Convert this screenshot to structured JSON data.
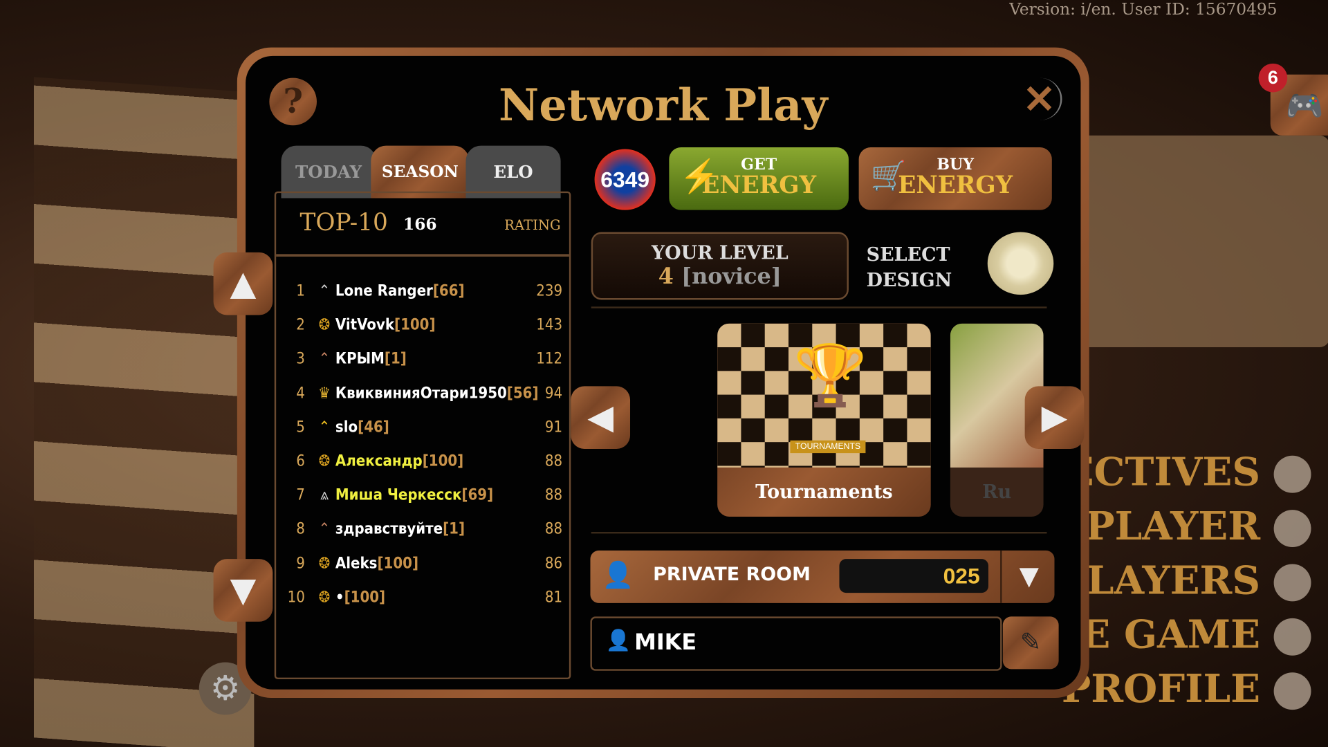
{
  "version_text": "Version:  i/en. User ID: 15670495",
  "notification_count": "6",
  "background_menu": [
    "JECTIVES",
    "PLAYER",
    "PLAYERS",
    "NE GAME",
    "PROFILE"
  ],
  "modal": {
    "title": "Network Play",
    "tabs": [
      {
        "label": "TODAY",
        "active": false
      },
      {
        "label": "SEASON 166",
        "active": true
      },
      {
        "label": "ELO",
        "active": false
      }
    ],
    "leaderboard": {
      "title": "TOP-10",
      "rating_label": "RATING",
      "rows": [
        {
          "rank": "1",
          "name": "Lone Ranger",
          "level": "[66]",
          "rating": "239",
          "name_color": "#ffffff",
          "icon": "chevron-silver"
        },
        {
          "rank": "2",
          "name": "VitVovk",
          "level": "[100]",
          "rating": "143",
          "name_color": "#ffffff",
          "icon": "laurel-emblem"
        },
        {
          "rank": "3",
          "name": "КРЫМ",
          "level": "[1]",
          "rating": "112",
          "name_color": "#ffffff",
          "icon": "chevron-bronze"
        },
        {
          "rank": "4",
          "name": "КвиквинияОтари1950",
          "level": "[56]",
          "rating": "94",
          "name_color": "#ffffff",
          "icon": "eagle-emblem"
        },
        {
          "rank": "5",
          "name": "slo",
          "level": "[46]",
          "rating": "91",
          "name_color": "#ffffff",
          "icon": "chevron-gold"
        },
        {
          "rank": "6",
          "name": "Александр",
          "level": "[100]",
          "rating": "88",
          "name_color": "#f0f040",
          "icon": "laurel-emblem"
        },
        {
          "rank": "7",
          "name": "Миша Черкесск",
          "level": "[69]",
          "rating": "88",
          "name_color": "#f0f040",
          "icon": "chevron-silver-triple"
        },
        {
          "rank": "8",
          "name": "здравствуйте",
          "level": "[1]",
          "rating": "88",
          "name_color": "#ffffff",
          "icon": "chevron-bronze"
        },
        {
          "rank": "9",
          "name": "Aleks",
          "level": "[100]",
          "rating": "86",
          "name_color": "#ffffff",
          "icon": "laurel-emblem"
        },
        {
          "rank": "10",
          "name": "•",
          "level": "[100]",
          "rating": "81",
          "name_color": "#ffffff",
          "icon": "laurel-emblem"
        }
      ]
    },
    "energy": "6349",
    "get_energy": {
      "small": "GET",
      "big": "ENERGY"
    },
    "buy_energy": {
      "small": "BUY",
      "big": "ENERGY"
    },
    "your_level": {
      "label": "YOUR LEVEL",
      "value": "4",
      "rank": "[novice]"
    },
    "select_design": "SELECT\nDESIGN",
    "cards": [
      {
        "label": "Tournaments",
        "badge": "TOURNAMENTS"
      },
      {
        "label": "Ru"
      }
    ],
    "private_room": {
      "label": "PRIVATE ROOM",
      "code": "025"
    },
    "player_name": "MIKE"
  }
}
